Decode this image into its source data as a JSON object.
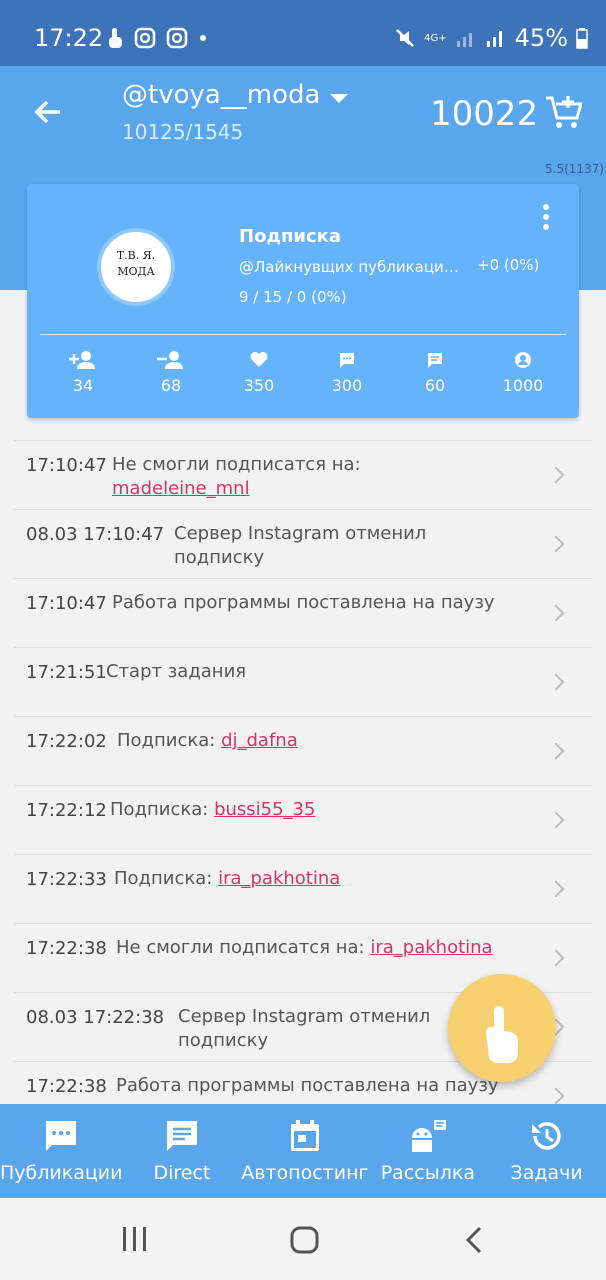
{
  "status": {
    "time": "17:22",
    "battery": "45%",
    "network": "4G+"
  },
  "header": {
    "account": "@tvoya__moda",
    "account_sub": "10125/1545",
    "balance": "10022",
    "version": "5.5(1137)"
  },
  "card": {
    "title": "Подписка",
    "subtitle": "@Лайкнувщих публикацию @Ariannalolo",
    "delta": "+0 (0%)",
    "progress": "9 / 15 / 0 (0%)",
    "avatar_text_1": "Т.В. Я.",
    "avatar_text_2": "МОДА",
    "stats": [
      {
        "icon": "add-user-icon",
        "value": "34"
      },
      {
        "icon": "remove-user-icon",
        "value": "68"
      },
      {
        "icon": "heart-icon",
        "value": "350"
      },
      {
        "icon": "comment-icon",
        "value": "300"
      },
      {
        "icon": "message-icon",
        "value": "60"
      },
      {
        "icon": "user-circle-icon",
        "value": "1000"
      }
    ]
  },
  "log": [
    {
      "time": "17:10:47",
      "text": "Не смогли подписатся на:",
      "link": "madeleine_mnl"
    },
    {
      "time": "08.03 17:10:47",
      "text": "Сервер Instagram отменил подписку",
      "link": ""
    },
    {
      "time": "17:10:47",
      "text": "Работа программы поставлена на паузу",
      "link": ""
    },
    {
      "time": "17:21:51",
      "text": "Старт задания",
      "link": ""
    },
    {
      "time": "17:22:02",
      "text": "Подписка:",
      "link": "dj_dafna"
    },
    {
      "time": "17:22:12",
      "text": "Подписка:",
      "link": "bussi55_35"
    },
    {
      "time": "17:22:33",
      "text": "Подписка:",
      "link": "ira_pakhotina"
    },
    {
      "time": "17:22:38",
      "text": "Не смогли подписатся на:",
      "link": "ira_pakhotina"
    },
    {
      "time": "08.03 17:22:38",
      "text": "Сервер Instagram отменил подписку",
      "link": ""
    },
    {
      "time": "17:22:38",
      "text": "Работа программы поставлена на паузу",
      "link": ""
    }
  ],
  "nav": [
    {
      "label": "Публикации",
      "icon": "publications-icon"
    },
    {
      "label": "Direct",
      "icon": "direct-icon"
    },
    {
      "label": "Автопостинг",
      "icon": "calendar-icon"
    },
    {
      "label": "Рассылка",
      "icon": "android-broadcast-icon"
    },
    {
      "label": "Задачи",
      "icon": "history-icon"
    }
  ],
  "colors": {
    "primary": "#5aa6ec",
    "statusbar": "#3c73b9",
    "card": "#64b3fb",
    "link": "#d6336c",
    "fab": "#f6d06e"
  }
}
